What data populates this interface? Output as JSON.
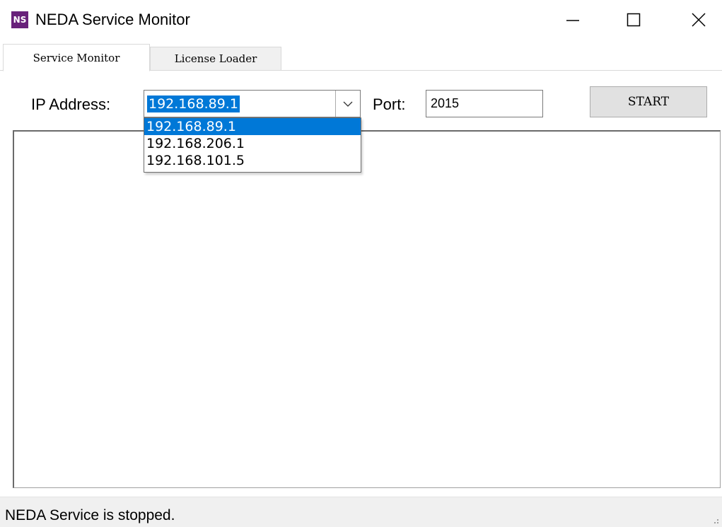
{
  "window": {
    "app_icon_text": "NS",
    "title": "NEDA Service Monitor"
  },
  "tabs": [
    {
      "label": "Service Monitor",
      "active": true
    },
    {
      "label": "License Loader",
      "active": false
    }
  ],
  "controls": {
    "ip_label": "IP Address:",
    "ip_value": "192.168.89.1",
    "ip_options": [
      "192.168.89.1",
      "192.168.206.1",
      "192.168.101.5"
    ],
    "port_label": "Port:",
    "port_value": "2015",
    "start_label": "START"
  },
  "status": {
    "text": "NEDA Service is stopped."
  },
  "colors": {
    "accent": "#0078d7",
    "app_icon_bg": "#68217a"
  },
  "icons": {
    "minimize": "minimize-icon",
    "maximize": "maximize-icon",
    "close": "close-icon",
    "dropdown": "chevron-down-icon"
  }
}
